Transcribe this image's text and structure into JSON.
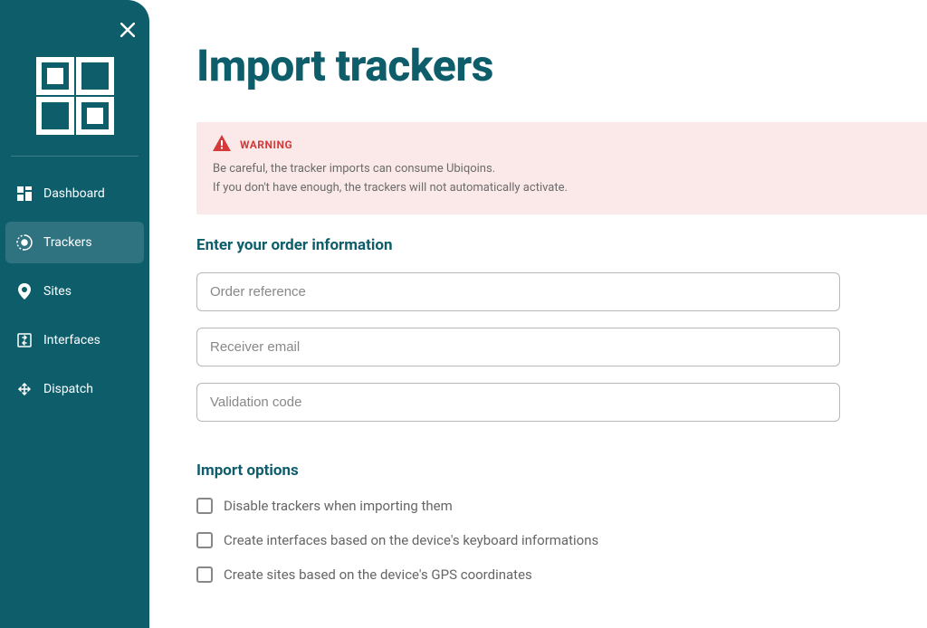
{
  "sidebar": {
    "items": [
      {
        "label": "Dashboard"
      },
      {
        "label": "Trackers"
      },
      {
        "label": "Sites"
      },
      {
        "label": "Interfaces"
      },
      {
        "label": "Dispatch"
      }
    ]
  },
  "page": {
    "title": "Import trackers"
  },
  "warning": {
    "title": "WARNING",
    "line1": "Be careful, the tracker imports can consume Ubiqoins.",
    "line2": "If you don't have enough, the trackers will not automatically activate."
  },
  "form": {
    "section_title": "Enter your order information",
    "order_ref_placeholder": "Order reference",
    "receiver_email_placeholder": "Receiver email",
    "validation_code_placeholder": "Validation code"
  },
  "options": {
    "section_title": "Import options",
    "items": [
      {
        "label": "Disable trackers when importing them"
      },
      {
        "label": "Create interfaces based on the device's keyboard informations"
      },
      {
        "label": "Create sites based on the device's GPS coordinates"
      }
    ]
  }
}
